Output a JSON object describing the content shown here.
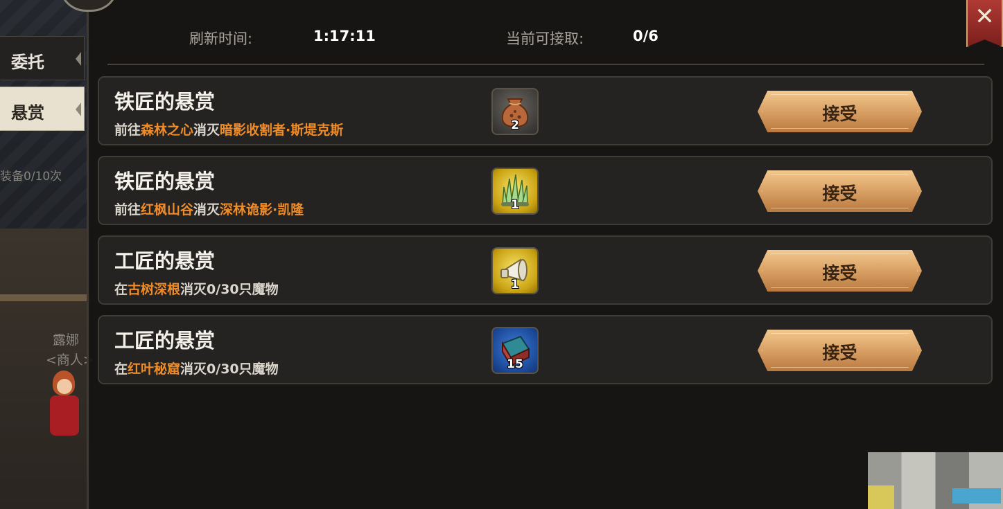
{
  "left": {
    "ghost_texts": [
      "装备0/10次",
      "露娜",
      "<商人>"
    ],
    "tabs": [
      {
        "label": "委托",
        "active": false
      },
      {
        "label": "悬赏",
        "active": true
      }
    ]
  },
  "header": {
    "refresh_label": "刷新时间:",
    "refresh_value": "1:17:11",
    "available_label": "当前可接取:",
    "available_value": "0/6",
    "close_symbol": "✕"
  },
  "bounties": [
    {
      "title": "铁匠的悬赏",
      "desc": [
        "前往",
        "森林之心",
        "消灭",
        "暗影收割者·斯堤克斯"
      ],
      "reward_icon": "pouch-icon",
      "reward_bg": "gray",
      "reward_qty": "2",
      "button": "接受"
    },
    {
      "title": "铁匠的悬赏",
      "desc": [
        "前往",
        "红枫山谷",
        "消灭",
        "深林诡影·凯隆"
      ],
      "reward_icon": "crystal-spikes-icon",
      "reward_bg": "gold",
      "reward_qty": "1",
      "button": "接受"
    },
    {
      "title": "工匠的悬赏",
      "desc": [
        "在",
        "古树深根",
        "消灭0/30只魔物"
      ],
      "reward_icon": "horn-icon",
      "reward_bg": "gold",
      "reward_qty": "1",
      "button": "接受"
    },
    {
      "title": "工匠的悬赏",
      "desc": [
        "在",
        "红叶秘窟",
        "消灭0/30只魔物"
      ],
      "reward_icon": "book-icon",
      "reward_bg": "blue",
      "reward_qty": "15",
      "button": "接受"
    }
  ],
  "colors": {
    "highlight": "#f08c28",
    "button": "#dca468",
    "close": "#b03a34"
  }
}
